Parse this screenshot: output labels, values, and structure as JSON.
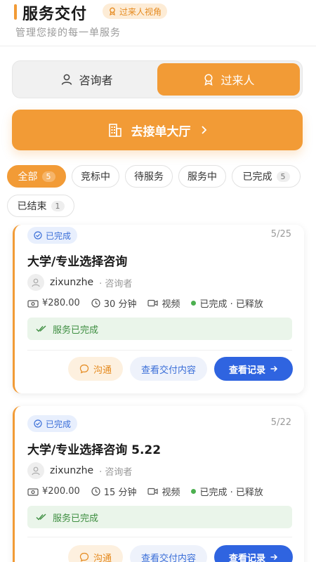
{
  "header": {
    "title": "服务交付",
    "view_badge": "过来人视角",
    "subtitle": "管理您接的每一单服务"
  },
  "role_switch": {
    "consultant": "咨询者",
    "mentor": "过来人"
  },
  "hall_button": {
    "label": "去接单大厅"
  },
  "filters": [
    {
      "label": "全部",
      "count": "5"
    },
    {
      "label": "竞标中"
    },
    {
      "label": "待服务"
    },
    {
      "label": "服务中"
    },
    {
      "label": "已完成",
      "count": "5"
    },
    {
      "label": "已结束",
      "count": "1"
    }
  ],
  "orders": [
    {
      "status": "已完成",
      "date": "5/25",
      "title": "大学/专业选择咨询",
      "username": "zixunzhe",
      "role": "· 咨询者",
      "price": "¥280.00",
      "duration": "30 分钟",
      "mode": "视频",
      "state": "已完成 · 已释放",
      "done_text": "服务已完成",
      "chat_label": "沟通",
      "view_label": "查看交付内容",
      "record_label": "查看记录"
    },
    {
      "status": "已完成",
      "date": "5/22",
      "title": "大学/专业选择咨询 5.22",
      "username": "zixunzhe",
      "role": "· 咨询者",
      "price": "¥200.00",
      "duration": "15 分钟",
      "mode": "视频",
      "state": "已完成 · 已释放",
      "done_text": "服务已完成",
      "chat_label": "沟通",
      "view_label": "查看交付内容",
      "record_label": "查看记录"
    }
  ],
  "colors": {
    "accent": "#f29b36",
    "primary_blue": "#2f64e0",
    "success_green": "#4cb04f"
  }
}
